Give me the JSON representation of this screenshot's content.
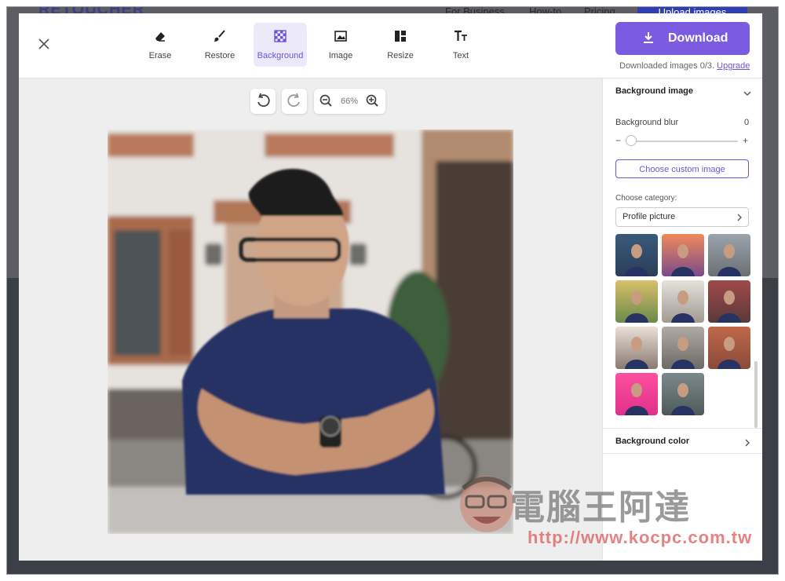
{
  "background_site": {
    "logo": "RETOUCHER",
    "nav": [
      "For Business",
      "How-to",
      "Pricing"
    ],
    "upload_button": "Upload images"
  },
  "toolbar": {
    "tools": [
      {
        "label": "Erase",
        "icon": "eraser-icon"
      },
      {
        "label": "Restore",
        "icon": "brush-icon"
      },
      {
        "label": "Background",
        "icon": "checkerboard-icon",
        "active": true
      },
      {
        "label": "Image",
        "icon": "image-icon"
      },
      {
        "label": "Resize",
        "icon": "layout-icon"
      },
      {
        "label": "Text",
        "icon": "text-icon"
      }
    ]
  },
  "download": {
    "label": "Download",
    "note": "Downloaded images 0/3.",
    "upgrade": "Upgrade"
  },
  "canvas": {
    "zoom": "66%"
  },
  "panel": {
    "background_image": {
      "title": "Background image",
      "blur_label": "Background blur",
      "blur_value": "0",
      "minus": "−",
      "plus": "+",
      "custom_button": "Choose custom image",
      "category_label": "Choose category:",
      "category_value": "Profile picture"
    },
    "background_color": {
      "title": "Background color"
    }
  },
  "watermark": {
    "brand": "電腦王阿達",
    "url": "http://www.kocpc.com.tw"
  },
  "colors": {
    "accent": "#7b5ce0",
    "active_bg": "#ece9fb",
    "canvas_bg": "#eeeeee"
  }
}
